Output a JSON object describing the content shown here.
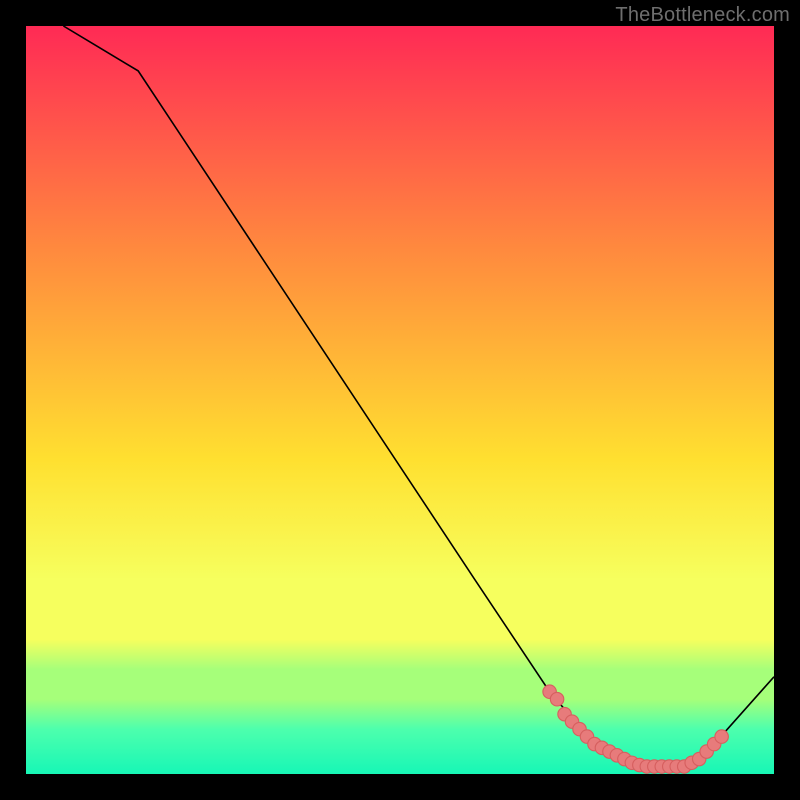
{
  "watermark": "TheBottleneck.com",
  "colors": {
    "curve": "#000000",
    "marker_fill": "#e77b7b",
    "marker_stroke": "#d65f5f",
    "gradient_top": "#ff2a55",
    "gradient_mid_upper": "#ff8a3e",
    "gradient_mid": "#ffe030",
    "gradient_lower": "#f6ff5e",
    "gradient_green1": "#a6ff7a",
    "gradient_green2": "#4dffad",
    "gradient_bottom": "#17f7b6"
  },
  "chart_data": {
    "type": "line",
    "title": "",
    "xlabel": "",
    "ylabel": "",
    "xlim": [
      0,
      100
    ],
    "ylim": [
      0,
      100
    ],
    "series": [
      {
        "name": "bottleneck-curve",
        "x": [
          5,
          10,
          15,
          60,
          70,
          76,
          80,
          84,
          88,
          90,
          92,
          100
        ],
        "y": [
          100,
          97,
          94,
          26,
          11,
          4,
          2,
          1,
          1,
          2,
          4,
          13
        ]
      }
    ],
    "markers": {
      "name": "highlight-points",
      "x": [
        70,
        71,
        72,
        73,
        74,
        75,
        76,
        77,
        78,
        79,
        80,
        81,
        82,
        83,
        84,
        85,
        86,
        87,
        88,
        89,
        90,
        91,
        92,
        93
      ],
      "y": [
        11,
        10,
        8,
        7,
        6,
        5,
        4,
        3.5,
        3,
        2.5,
        2,
        1.5,
        1.2,
        1,
        1,
        1,
        1,
        1,
        1,
        1.5,
        2,
        3,
        4,
        5
      ]
    },
    "gradient_stops_pct": [
      0,
      30,
      58,
      74,
      82,
      86,
      90,
      94,
      100
    ]
  }
}
